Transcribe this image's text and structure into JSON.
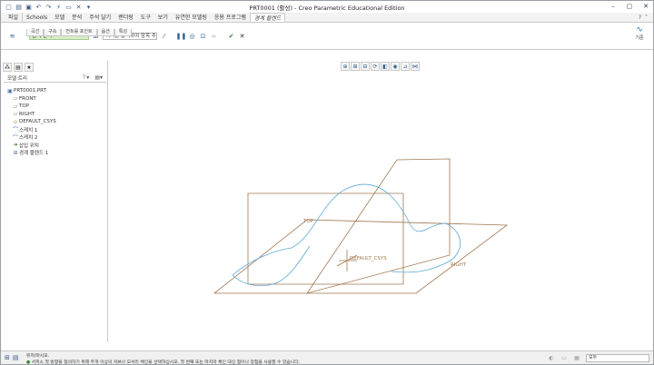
{
  "window": {
    "title": "PRT0001 (활성) - Creo Parametric Educational Edition"
  },
  "quick_access": {
    "icons": [
      "new-icon",
      "open-icon",
      "save-icon",
      "undo-icon",
      "redo-icon",
      "regenerate-icon",
      "window-icon",
      "close-icon",
      "more-icon"
    ]
  },
  "menu": {
    "tabs": [
      "파일",
      "Schools",
      "모델",
      "분석",
      "주석 달기",
      "렌더링",
      "도구",
      "보기",
      "유연한 모델링",
      "응용 프로그램",
      "경계 블렌드"
    ],
    "active_tab": "경계 블렌드"
  },
  "ribbon": {
    "selection_field": "탐색 선택",
    "direction_field": "여기를 클릭하여 항목 추",
    "subtabs": [
      "곡선",
      "구속",
      "컨트롤 포인트",
      "옵션",
      "특성"
    ],
    "style_label": "기준"
  },
  "panel": {
    "header": "모델 트리",
    "tree": [
      {
        "label": "PRT0001.PRT",
        "icon": "part-icon",
        "level": 0
      },
      {
        "label": "FRONT",
        "icon": "datum-plane-icon",
        "level": 1
      },
      {
        "label": "TOP",
        "icon": "datum-plane-icon",
        "level": 1
      },
      {
        "label": "RIGHT",
        "icon": "datum-plane-icon",
        "level": 1
      },
      {
        "label": "DEFAULT_CSYS",
        "icon": "csys-icon",
        "level": 1
      },
      {
        "label": "스케치 1",
        "icon": "sketch-icon",
        "level": 1
      },
      {
        "label": "스케치 2",
        "icon": "sketch-icon",
        "level": 1
      },
      {
        "label": "삽입 위치",
        "icon": "insert-here-icon",
        "level": 1
      },
      {
        "label": "경계 블렌드 1",
        "icon": "boundary-blend-icon",
        "level": 1
      }
    ]
  },
  "graphics": {
    "labels": {
      "top": "TOP",
      "csys": "DEFAULT_CSYS",
      "right": "RIGHT"
    },
    "colors": {
      "datum_plane": "#a07850",
      "curve": "#5aa8d8"
    }
  },
  "status": {
    "line1": "유저/마시오.",
    "line2": "서피스 첫 방향을 정의하기 위해 두개 이상의 커브나 모서리 체인을 선택하십시오. 첫 번째 또는 마지막 체인 대신 점이나 정점을 사용할 수 있습니다.",
    "filter": "모두"
  }
}
